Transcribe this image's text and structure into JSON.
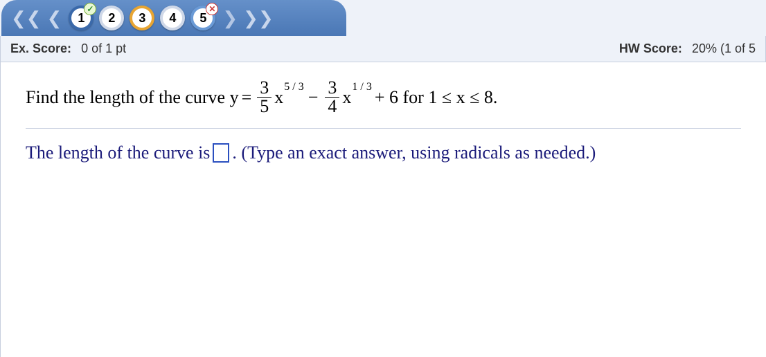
{
  "nav": {
    "steps": [
      {
        "num": "1",
        "ring": "ring-blue",
        "badge": "check"
      },
      {
        "num": "2",
        "ring": "ring-none",
        "badge": null
      },
      {
        "num": "3",
        "ring": "ring-yellow",
        "badge": null
      },
      {
        "num": "4",
        "ring": "ring-none",
        "badge": null
      },
      {
        "num": "5",
        "ring": "ring-blue-light",
        "badge": "cross"
      }
    ]
  },
  "score": {
    "ex_label": "Ex. Score:",
    "ex_value": "0 of 1 pt",
    "hw_label": "HW Score:",
    "hw_value": "20% (1 of 5"
  },
  "problem": {
    "prefix": "Find the length of the curve y",
    "eq": "=",
    "f1_num": "3",
    "f1_den": "5",
    "x1_base": "x",
    "x1_exp": "5 / 3",
    "minus": "−",
    "f2_num": "3",
    "f2_den": "4",
    "x2_base": "x",
    "x2_exp": "1 / 3",
    "plus_tail": "+ 6 for 1 ≤ x ≤ 8."
  },
  "answer": {
    "prefix": "The length of the curve is",
    "suffix": ". (Type an exact answer, using radicals as needed.)"
  }
}
